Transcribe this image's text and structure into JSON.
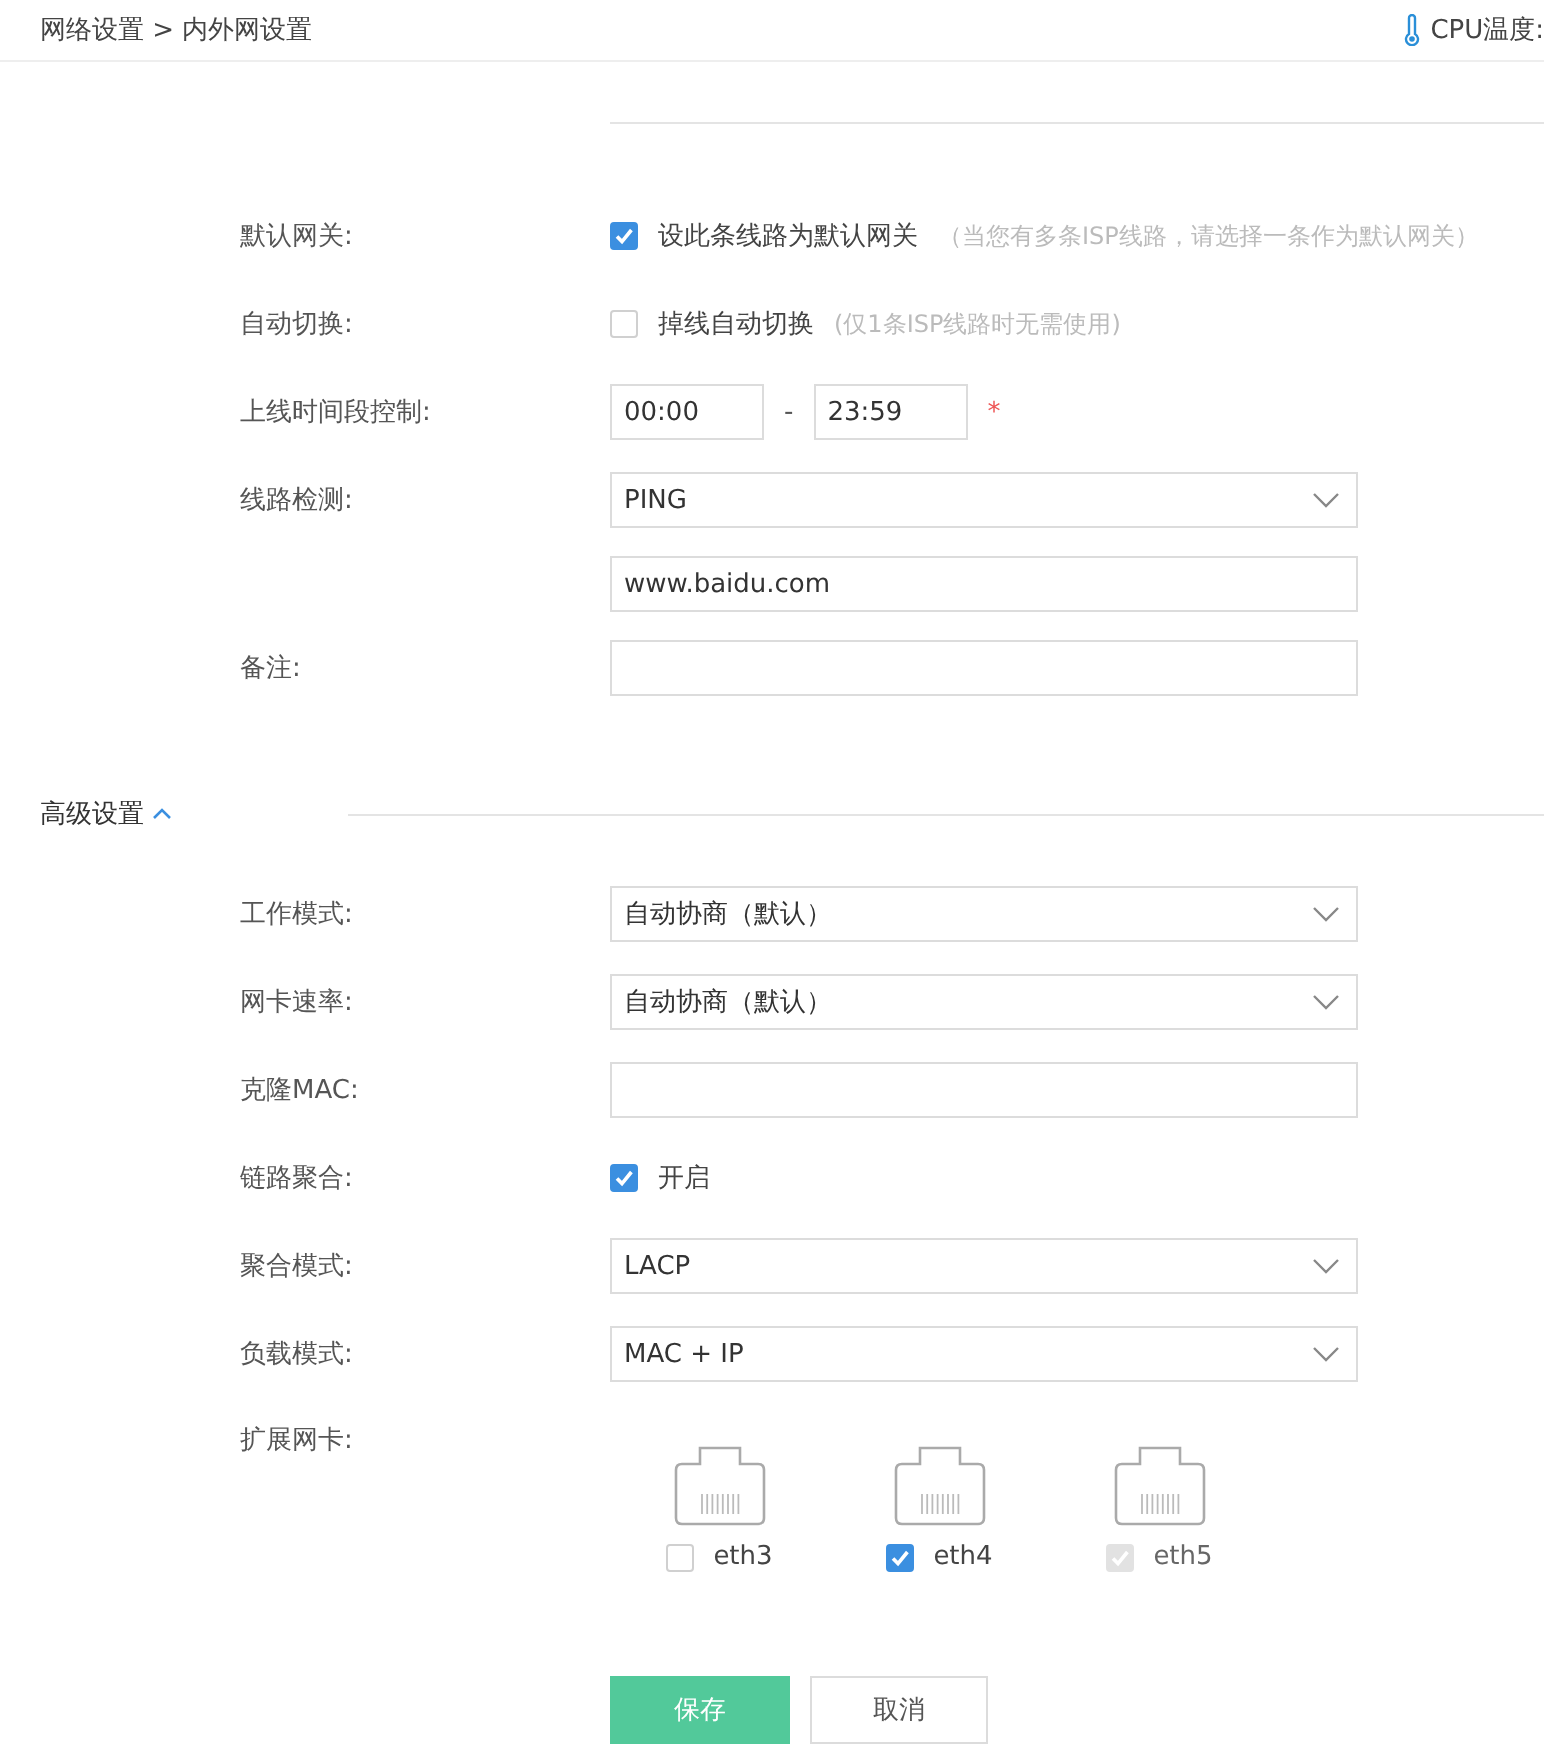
{
  "breadcrumb": {
    "path": "网络设置",
    "separator": ">",
    "current": "内外网设置"
  },
  "cpu_label": "CPU温度:",
  "basic_fields": [
    {
      "label": "默认网关:",
      "kind": "checkbox",
      "checked": true,
      "text": "设此条线路为默认网关",
      "hint": "（当您有多条ISP线路，请选择一条作为默认网关）"
    },
    {
      "label": "自动切换:",
      "kind": "checkbox",
      "checked": false,
      "text": "掉线自动切换",
      "hint": "(仅1条ISP线路时无需使用)"
    },
    {
      "label": "上线时间段控制:",
      "kind": "time_range",
      "start": "00:00",
      "separator": "-",
      "end": "23:59",
      "required_mark": "*"
    },
    {
      "label": "线路检测:",
      "kind": "select",
      "value": "PING"
    },
    {
      "kind": "input",
      "value": "www.baidu.com"
    },
    {
      "label": "备注:",
      "kind": "input"
    }
  ],
  "advanced": {
    "title": "高级设置",
    "expanded": true,
    "fields": [
      {
        "label": "工作模式:",
        "kind": "select",
        "value": "自动协商（默认）"
      },
      {
        "label": "网卡速率:",
        "kind": "select",
        "value": "自动协商（默认）"
      },
      {
        "label": "克隆MAC:",
        "kind": "input"
      },
      {
        "label": "链路聚合:",
        "kind": "checkbox",
        "checked": true,
        "text": "开启"
      },
      {
        "label": "聚合模式:",
        "kind": "select",
        "value": "LACP"
      },
      {
        "label": "负载模式:",
        "kind": "select",
        "value": "MAC + IP"
      },
      {
        "label": "扩展网卡:",
        "kind": "ports",
        "ports": [
          {
            "name": "eth3",
            "checked": false,
            "disabled": false
          },
          {
            "name": "eth4",
            "checked": true,
            "disabled": false
          },
          {
            "name": "eth5",
            "checked": true,
            "disabled": true
          }
        ]
      }
    ]
  },
  "buttons": [
    {
      "label": "保存",
      "kind": "primary"
    },
    {
      "label": "取消",
      "kind": "secondary"
    }
  ]
}
